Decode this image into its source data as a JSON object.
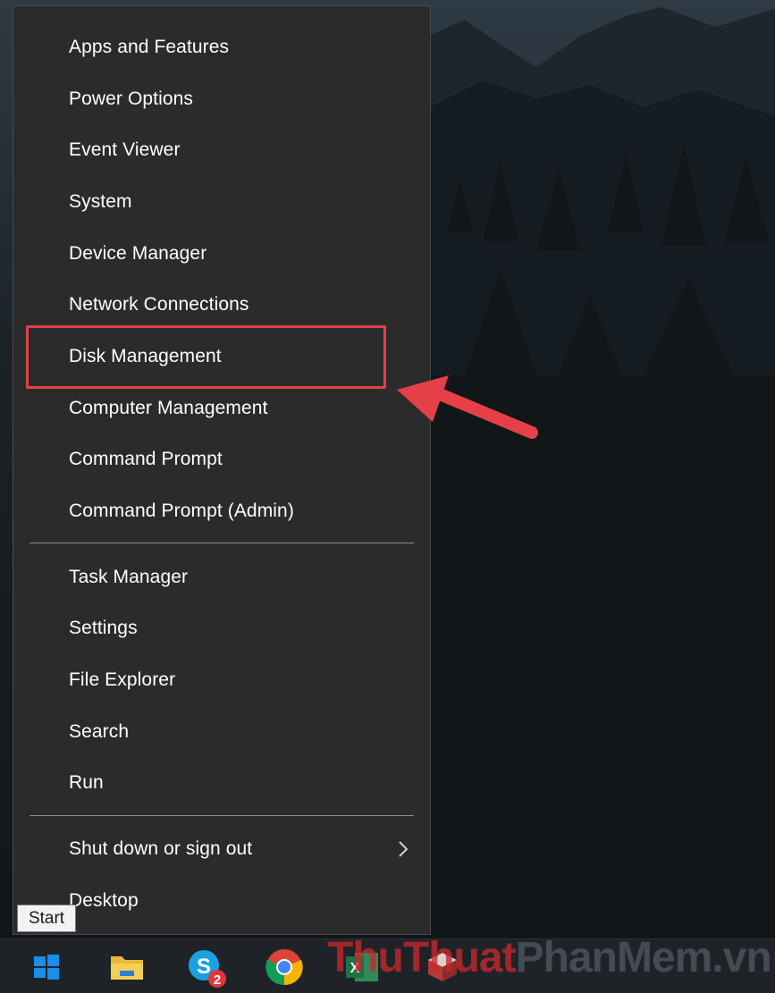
{
  "menu": {
    "group1": [
      {
        "label": "Apps and Features"
      },
      {
        "label": "Power Options"
      },
      {
        "label": "Event Viewer"
      },
      {
        "label": "System"
      },
      {
        "label": "Device Manager"
      },
      {
        "label": "Network Connections"
      },
      {
        "label": "Disk Management"
      },
      {
        "label": "Computer Management"
      },
      {
        "label": "Command Prompt"
      },
      {
        "label": "Command Prompt (Admin)"
      }
    ],
    "group2": [
      {
        "label": "Task Manager"
      },
      {
        "label": "Settings"
      },
      {
        "label": "File Explorer"
      },
      {
        "label": "Search"
      },
      {
        "label": "Run"
      }
    ],
    "group3": [
      {
        "label": "Shut down or sign out",
        "has_submenu": true
      },
      {
        "label": "Desktop"
      }
    ]
  },
  "highlighted_item": "Disk Management",
  "tooltip": {
    "text": "Start"
  },
  "taskbar": {
    "items": [
      {
        "icon": "windows-start-icon"
      },
      {
        "icon": "file-explorer-icon"
      },
      {
        "icon": "skype-icon",
        "badge": "2"
      },
      {
        "icon": "chrome-icon"
      },
      {
        "icon": "excel-icon",
        "letter": "X"
      },
      {
        "icon": "app-box-icon"
      }
    ]
  },
  "watermark": {
    "part1": "ThuThuat",
    "part2": "PhanMem",
    "part3": ".vn"
  },
  "colors": {
    "menu_bg": "#2b2b2b",
    "highlight": "#e54048",
    "taskbar_bg": "#1f2327",
    "windows_blue": "#1a8ee8"
  }
}
